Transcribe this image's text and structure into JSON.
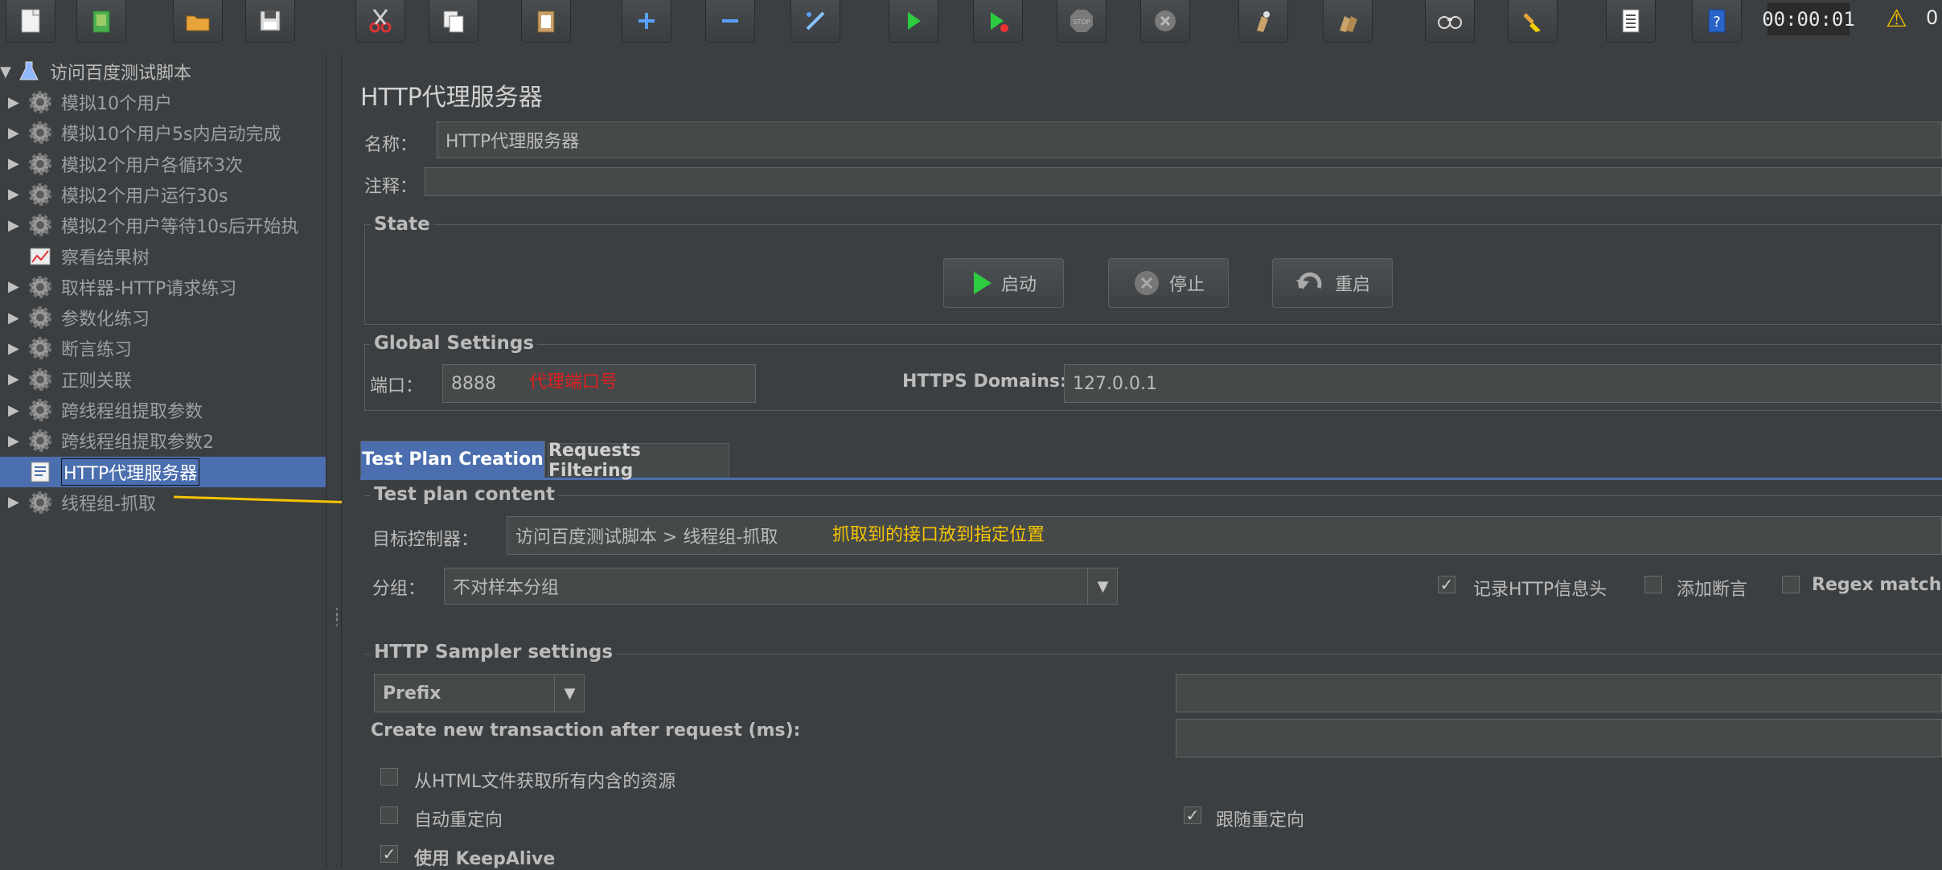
{
  "toolbar": {
    "buttons": [
      "new-icon",
      "templates-icon",
      "open-icon",
      "save-icon",
      "cut-icon",
      "copy-icon",
      "paste-icon",
      "expand-icon",
      "collapse-icon",
      "toggle-icon",
      "start-icon",
      "start-no-pause-icon",
      "stop-icon",
      "shutdown-icon",
      "clear-icon",
      "clear-all-icon",
      "search-icon",
      "reset-search-icon",
      "function-helper-icon",
      "help-icon"
    ],
    "timer": "00:00:01",
    "warning_count": "0"
  },
  "tree": {
    "root": "访问百度测试脚本",
    "items": [
      {
        "label": "模拟10个用户",
        "expandable": true,
        "icon": "gear-icon"
      },
      {
        "label": "模拟10个用户5s内启动完成",
        "expandable": true,
        "icon": "gear-icon"
      },
      {
        "label": "模拟2个用户各循环3次",
        "expandable": true,
        "icon": "gear-icon"
      },
      {
        "label": "模拟2个用户运行30s",
        "expandable": true,
        "icon": "gear-icon"
      },
      {
        "label": "模拟2个用户等待10s后开始执",
        "expandable": true,
        "icon": "gear-icon"
      },
      {
        "label": "察看结果树",
        "expandable": false,
        "icon": "chart-icon"
      },
      {
        "label": "取样器-HTTP请求练习",
        "expandable": true,
        "icon": "gear-icon"
      },
      {
        "label": "参数化练习",
        "expandable": true,
        "icon": "gear-icon"
      },
      {
        "label": "断言练习",
        "expandable": true,
        "icon": "gear-icon"
      },
      {
        "label": "正则关联",
        "expandable": true,
        "icon": "gear-icon"
      },
      {
        "label": "跨线程组提取参数",
        "expandable": true,
        "icon": "gear-icon"
      },
      {
        "label": "跨线程组提取参数2",
        "expandable": true,
        "icon": "gear-icon"
      },
      {
        "label": "HTTP代理服务器",
        "expandable": false,
        "icon": "proxy-icon",
        "selected": true
      },
      {
        "label": "线程组-抓取",
        "expandable": true,
        "icon": "gear-icon"
      }
    ]
  },
  "panel": {
    "title": "HTTP代理服务器",
    "name_label": "名称：",
    "name_value": "HTTP代理服务器",
    "comment_label": "注释：",
    "comment_value": "",
    "state": {
      "title": "State",
      "start": "启动",
      "stop": "停止",
      "restart": "重启"
    },
    "global": {
      "title": "Global Settings",
      "port_label": "端口：",
      "port_value": "8888",
      "port_annotation": "代理端口号",
      "https_label": "HTTPS Domains:",
      "https_value": "127.0.0.1"
    },
    "tabs": [
      "Test Plan Creation",
      "Requests Filtering"
    ],
    "test_plan": {
      "title": "Test plan content",
      "target_label": "目标控制器：",
      "target_value": "访问百度测试脚本 > 线程组-抓取",
      "target_annotation": "抓取到的接口放到指定位置",
      "group_label": "分组：",
      "group_value": "不对样本分组",
      "record_headers": "记录HTTP信息头",
      "record_headers_checked": true,
      "add_assertions": "添加断言",
      "add_assertions_checked": false,
      "regex_matching": "Regex matching",
      "regex_matching_checked": false
    },
    "sampler": {
      "title": "HTTP Sampler settings",
      "prefix_value": "Prefix",
      "transaction_label": "Create new transaction after request (ms):",
      "embedded": "从HTML文件获取所有内含的资源",
      "embedded_checked": false,
      "auto_redirect": "自动重定向",
      "auto_redirect_checked": false,
      "follow_redirect": "跟随重定向",
      "follow_redirect_checked": true,
      "keepalive": "使用 KeepAlive",
      "keepalive_checked": true
    }
  },
  "colors": {
    "background": "#3c3f41",
    "selection": "#4b6eaf",
    "annotation_red": "#e02020",
    "annotation_yellow": "#f5c400"
  }
}
